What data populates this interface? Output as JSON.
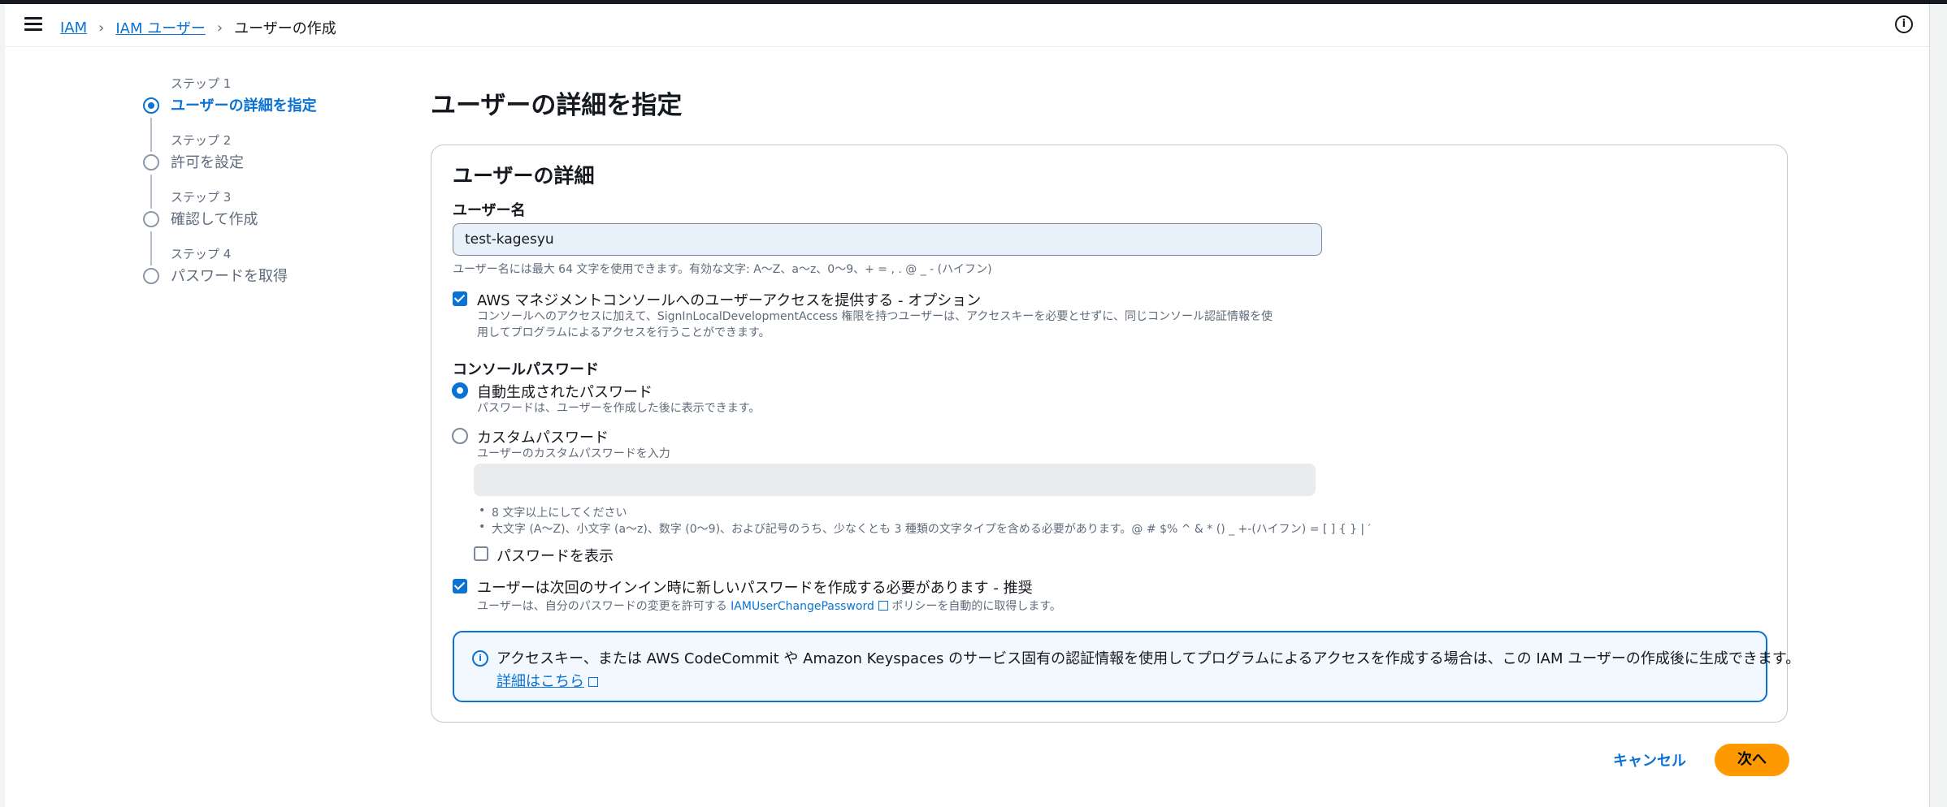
{
  "breadcrumb": {
    "items": [
      "IAM",
      "IAM ユーザー"
    ],
    "current": "ユーザーの作成"
  },
  "steps": [
    {
      "small": "ステップ 1",
      "label": "ユーザーの詳細を指定"
    },
    {
      "small": "ステップ 2",
      "label": "許可を設定"
    },
    {
      "small": "ステップ 3",
      "label": "確認して作成"
    },
    {
      "small": "ステップ 4",
      "label": "パスワードを取得"
    }
  ],
  "page_title": "ユーザーの詳細を指定",
  "panel": {
    "title": "ユーザーの詳細",
    "username_label": "ユーザー名",
    "username_value": "test-kagesyu",
    "username_hint": "ユーザー名には最大 64 文字を使用できます。有効な文字: A〜Z、a〜z、0〜9、+ = , . @ _ - (ハイフン)",
    "console_access_label": "AWS マネジメントコンソールへのユーザーアクセスを提供する - オプション",
    "console_access_desc_1": "コンソールへのアクセスに加えて、SignInLocalDevelopmentAccess 権限を持つユーザーは、アクセスキーを必要とせずに、同じコンソール認証情報を使",
    "console_access_desc_2": "用してプログラムによるアクセスを行うことができます。",
    "console_password_label": "コンソールパスワード",
    "auto_password_label": "自動生成されたパスワード",
    "auto_password_desc": "パスワードは、ユーザーを作成した後に表示できます。",
    "custom_password_label": "カスタムパスワード",
    "custom_password_desc": "ユーザーのカスタムパスワードを入力",
    "rule_1": "8 文字以上にしてください",
    "rule_2": "大文字 (A〜Z)、小文字 (a〜z)、数字 (0〜9)、および記号のうち、少なくとも 3 種類の文字タイプを含める必要があります。@ # $% ^ & * () _ +-(ハイフン) = [ ] { } | ′",
    "show_password_label": "パスワードを表示",
    "require_reset_label": "ユーザーは次回のサインイン時に新しいパスワードを作成する必要があります - 推奨",
    "require_reset_desc_pre": "ユーザーは、自分のパスワードの変更を許可する",
    "require_reset_link": "IAMUserChangePassword",
    "require_reset_desc_post": "ポリシーを自動的に取得します。",
    "info_text": "アクセスキー、または AWS CodeCommit や Amazon Keyspaces のサービス固有の認証情報を使用してプログラムによるアクセスを作成する場合は、この IAM ユーザーの作成後に生成できます。",
    "info_link": "詳細はこちら"
  },
  "actions": {
    "cancel": "キャンセル",
    "next": "次へ"
  },
  "colors": {
    "primary": "#0972d3",
    "next_button": "#ff9900"
  }
}
